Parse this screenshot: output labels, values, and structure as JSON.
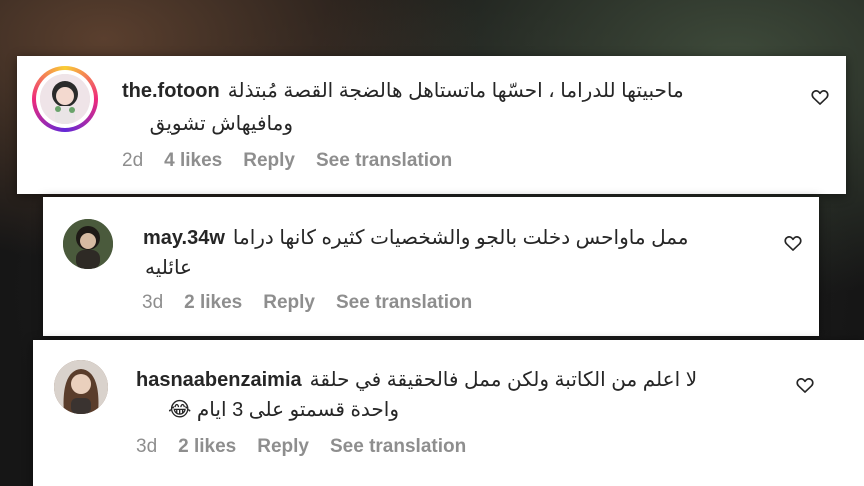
{
  "comments": [
    {
      "username": "the.fotoon",
      "line1": "ماحبيتها للدراما ، احسّها ماتستاهل هالضجة القصة مُبتذلة",
      "line2": "ومافيهاش تشويق",
      "age": "2d",
      "likes": "4 likes",
      "reply": "Reply",
      "see_translation": "See translation"
    },
    {
      "username": "may.34w",
      "line1": "ممل ماواحس دخلت بالجو والشخصيات كثيره كانها دراما",
      "line2": "عائليه",
      "age": "3d",
      "likes": "2 likes",
      "reply": "Reply",
      "see_translation": "See translation"
    },
    {
      "username": "hasnaabenzaimia",
      "line1": "لا اعلم من الكاتبة ولكن ممل فالحقيقة في حلقة",
      "line2": "واحدة قسمتو على 3 ايام 😂",
      "age": "3d",
      "likes": "2 likes",
      "reply": "Reply",
      "see_translation": "See translation"
    }
  ],
  "icons": {
    "heart": "heart-outline-icon",
    "avatar": "profile-avatar"
  },
  "colors": {
    "text": "#262626",
    "meta": "#8e8e8e",
    "card": "#ffffff"
  }
}
